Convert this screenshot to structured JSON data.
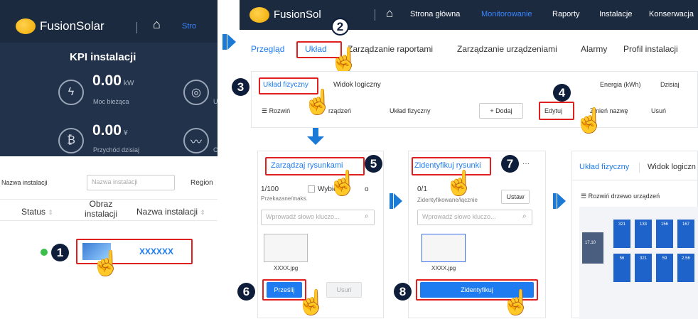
{
  "left": {
    "brand": "FusionSolar",
    "nav_partial": "Stro",
    "kpi_title": "KPI instalacji",
    "power_value": "0.00",
    "power_unit": "kW",
    "power_label": "Moc bieżąca",
    "income_value": "0.00",
    "income_unit": "¥",
    "income_label": "Przychód dzisiaj",
    "side_label_partial": "U",
    "side_label2_partial": "C",
    "filter_label": "Nazwa instalacji",
    "filter_placeholder": "Nazwa instalacji",
    "region_label": "Region",
    "col_status": "Status",
    "col_image": "Obraz instalacji",
    "col_name": "Nazwa instalacji",
    "row_name": "XXXXXX"
  },
  "top": {
    "brand": "FusionSol",
    "nav": [
      "Strona główna",
      "Monitorowanie",
      "Raporty",
      "Instalacje",
      "Konserwacja"
    ],
    "tabs": [
      "Przegląd",
      "Układ",
      "Zarządzanie raportami",
      "Zarządzanie urządzeniami",
      "Alarmy",
      "Profil instalacji"
    ],
    "subtab_physical": "Układ fizyczny",
    "subtab_logical": "Widok logiczny",
    "energy_label": "Energia (kWh)",
    "period": "Dzisiaj",
    "expand_label": "Rozwiń",
    "expand_suffix": "rządzeń",
    "layout_select": "Układ fizyczny",
    "add_btn": "+ Dodaj",
    "edit_btn": "Edytuj",
    "rename_btn": "Zmień nazwę",
    "delete_btn": "Usuń"
  },
  "manage": {
    "title": "Zarządzaj rysunkami",
    "count": "1/100",
    "select_label": "Wybierz",
    "select_suffix": "o",
    "sub": "Przekazane/maks.",
    "search_placeholder": "Wprowadź słowo kluczo...",
    "file": "XXXX.jpg",
    "upload_btn": "Prześlij",
    "delete_btn": "Usuń"
  },
  "identify": {
    "title": "Zidentyfikuj rysunki",
    "more": "···",
    "count": "0/1",
    "sub": "Zidentyfikowane/łącznie",
    "set_btn": "Ustaw",
    "search_placeholder": "Wprowadź słowo kluczo...",
    "file": "XXXX.jpg",
    "identify_btn": "Zidentyfikuj"
  },
  "result": {
    "tab_physical": "Układ fizyczny",
    "tab_logical": "Widok logiczn",
    "expand_label": "Rozwiń drzewo urządzeń",
    "top_values": [
      "321",
      "133",
      "156",
      "167"
    ],
    "bottom_values": [
      "56",
      "321",
      "59",
      "2.56"
    ],
    "side_value": "17.10"
  },
  "steps": [
    "1",
    "2",
    "3",
    "4",
    "5",
    "6",
    "7",
    "8"
  ],
  "colors": {
    "accent": "#1f7cf0",
    "highlight": "#e0201e",
    "header": "#1b2a3f",
    "monitor": "#3a86ff"
  }
}
